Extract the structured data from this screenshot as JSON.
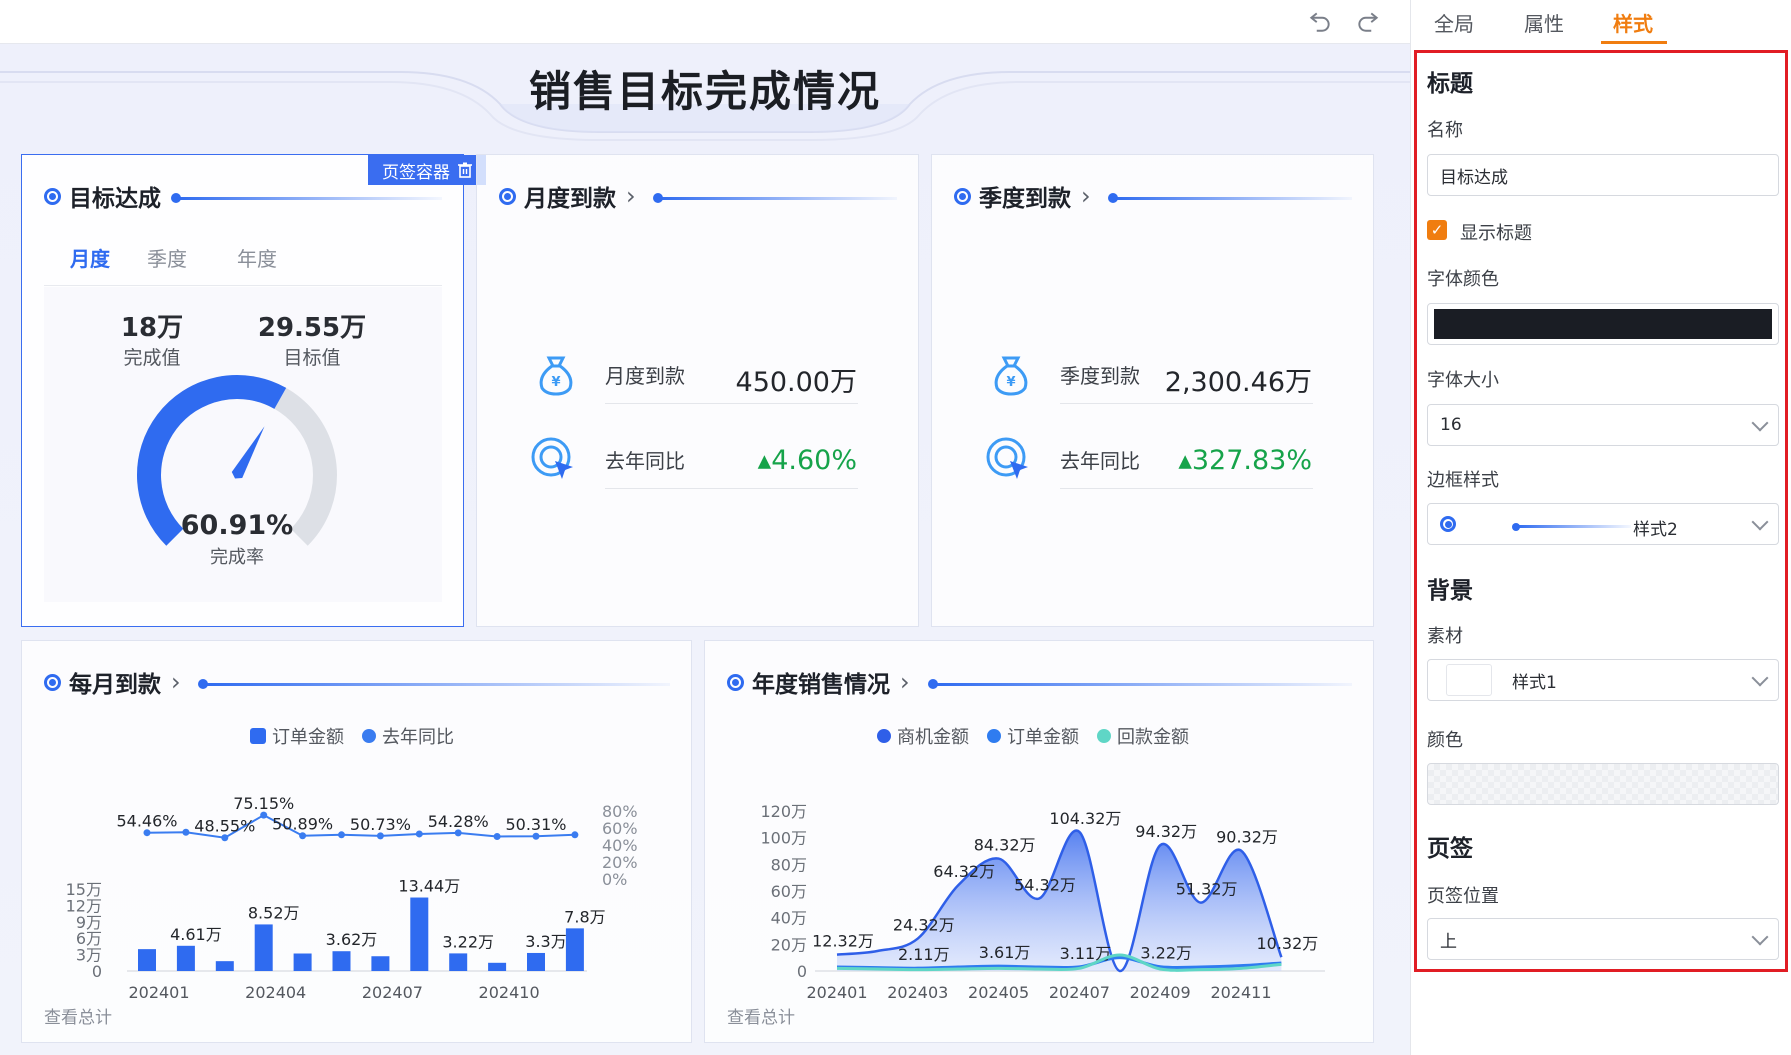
{
  "page": {
    "title": "销售目标完成情况"
  },
  "toolbar": {
    "undo": "undo-icon",
    "redo": "redo-icon"
  },
  "target_card": {
    "title": "目标达成",
    "tag": "页签容器",
    "tabs": [
      "月度",
      "季度",
      "年度"
    ],
    "active_tab": "月度",
    "completed_value": "18万",
    "completed_label": "完成值",
    "target_value": "29.55万",
    "target_label": "目标值",
    "rate": "60.91%",
    "rate_label": "完成率",
    "rate_fraction": 0.6091,
    "colors": {
      "gauge": "#2f6bf0",
      "track": "#dde0e6"
    }
  },
  "monthly_payment": {
    "title": "月度到款",
    "label": "月度到款",
    "value": "450.00万",
    "yoy_label": "去年同比",
    "yoy_value": "▴4.60%"
  },
  "quarter_payment": {
    "title": "季度到款",
    "label": "季度到款",
    "value": "2,300.46万",
    "yoy_label": "去年同比",
    "yoy_value": "▴327.83%"
  },
  "monthly_chart": {
    "title": "每月到款",
    "footer": "查看总计",
    "legend": [
      "订单金额",
      "去年同比"
    ]
  },
  "annual_chart": {
    "title": "年度销售情况",
    "footer": "查看总计",
    "legend": [
      "商机金额",
      "订单金额",
      "回款金额"
    ]
  },
  "chart_data": [
    {
      "type": "bar",
      "categories": [
        "202401",
        "202402",
        "202403",
        "202404",
        "202405",
        "202406",
        "202407",
        "202408",
        "202409",
        "202410",
        "202411",
        "202412"
      ],
      "x_tick_labels": [
        "202401",
        "202404",
        "202407",
        "202410"
      ],
      "series": [
        {
          "name": "订单金额",
          "type": "bar",
          "values": [
            4.0,
            4.61,
            1.8,
            8.52,
            3.2,
            3.62,
            2.7,
            13.44,
            3.22,
            1.5,
            3.3,
            7.8
          ],
          "data_labels": {
            "1": "4.61万",
            "3": "8.52万",
            "5": "3.62万",
            "7": "13.44万",
            "8": "3.22万",
            "10": "3.3万",
            "11": "7.8万"
          }
        },
        {
          "name": "去年同比",
          "type": "line",
          "values": [
            54.46,
            55.0,
            48.55,
            75.15,
            50.89,
            52.0,
            50.73,
            53.0,
            54.28,
            50.0,
            50.31,
            52.0
          ],
          "data_labels": {
            "0": "54.46%",
            "2": "48.55%",
            "3": "75.15%",
            "4": "50.89%",
            "6": "50.73%",
            "8": "54.28%",
            "10": "50.31%"
          }
        }
      ],
      "y_bar_ticks": [
        "0",
        "3万",
        "6万",
        "9万",
        "12万",
        "15万"
      ],
      "ylim_bar": [
        0,
        15
      ],
      "y_line_ticks": [
        "0%",
        "20%",
        "40%",
        "60%",
        "80%"
      ],
      "ylim_line": [
        0,
        80
      ],
      "colors": {
        "bar": "#2f6bf0",
        "line": "#3a7cf0"
      }
    },
    {
      "type": "area",
      "categories": [
        "202401",
        "202402",
        "202403",
        "202404",
        "202405",
        "202406",
        "202407",
        "202408",
        "202409",
        "202410",
        "202411",
        "202412"
      ],
      "x_tick_labels": [
        "202401",
        "202403",
        "202405",
        "202407",
        "202409",
        "202411"
      ],
      "series": [
        {
          "name": "商机金额",
          "values": [
            12.32,
            15.0,
            24.32,
            64.32,
            84.32,
            54.32,
            104.32,
            0,
            94.32,
            51.32,
            90.32,
            10.32
          ],
          "data_labels": {
            "0": "12.32万",
            "2": "24.32万",
            "3": "64.32万",
            "4": "84.32万",
            "5": "54.32万",
            "6": "104.32万",
            "8": "94.32万",
            "9": "51.32万",
            "10": "90.32万",
            "11": "10.32万"
          }
        },
        {
          "name": "订单金额",
          "values": [
            3.0,
            2.5,
            2.11,
            3.0,
            3.61,
            3.0,
            3.11,
            10.0,
            3.22,
            3.0,
            4.0,
            6.0
          ],
          "data_labels": {
            "2": "2.11万",
            "4": "3.61万",
            "6": "3.11万",
            "8": "3.22万"
          }
        },
        {
          "name": "回款金额",
          "values": [
            2.0,
            1.5,
            1.0,
            1.5,
            2.0,
            1.5,
            2.0,
            12.0,
            1.5,
            1.0,
            2.0,
            5.0
          ]
        }
      ],
      "y_ticks": [
        "0",
        "20万",
        "40万",
        "60万",
        "80万",
        "100万",
        "120万"
      ],
      "ylim": [
        0,
        120
      ],
      "colors": {
        "商机金额": "#2f5fe8",
        "订单金额": "#2f7cf0",
        "回款金额": "#5fd6c6"
      }
    }
  ],
  "panel": {
    "tabs": [
      "全局",
      "属性",
      "样式"
    ],
    "active_tab": "样式",
    "sections": {
      "title": "标题",
      "name_label": "名称",
      "name_value": "目标达成",
      "show_title_label": "显示标题",
      "show_title_checked": true,
      "font_color_label": "字体颜色",
      "font_color": "#1a1d24",
      "font_size_label": "字体大小",
      "font_size_value": "16",
      "border_style_label": "边框样式",
      "border_style_value": "样式2",
      "background": "背景",
      "material_label": "素材",
      "material_value": "样式1",
      "color_label": "颜色",
      "tabs_section": "页签",
      "tab_position_label": "页签位置",
      "tab_position_value": "上"
    }
  }
}
